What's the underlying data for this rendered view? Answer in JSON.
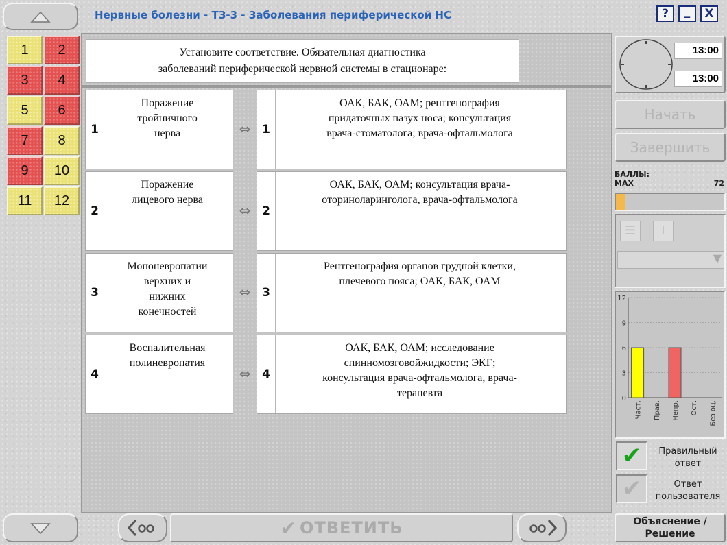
{
  "window": {
    "title": "Нервные болезни - ТЗ-3 - Заболевания периферической НС",
    "help_label": "?",
    "minimize_label": "_",
    "close_label": "X"
  },
  "questions": [
    {
      "label": "1",
      "status": "yellow"
    },
    {
      "label": "2",
      "status": "red"
    },
    {
      "label": "3",
      "status": "red"
    },
    {
      "label": "4",
      "status": "red"
    },
    {
      "label": "5",
      "status": "yellow"
    },
    {
      "label": "6",
      "status": "red"
    },
    {
      "label": "7",
      "status": "red"
    },
    {
      "label": "8",
      "status": "yellow"
    },
    {
      "label": "9",
      "status": "red"
    },
    {
      "label": "10",
      "status": "yellow"
    },
    {
      "label": "11",
      "status": "yellow"
    },
    {
      "label": "12",
      "status": "yellow"
    }
  ],
  "question": {
    "line1": "Установите соответствие. Обязательная диагностика",
    "line2": "заболеваний периферической нервной системы в стационаре:"
  },
  "left_items": [
    {
      "num": "1",
      "lines": [
        "Поражение",
        "тройничного",
        "нерва"
      ]
    },
    {
      "num": "2",
      "lines": [
        "Поражение",
        "лицевого нерва"
      ]
    },
    {
      "num": "3",
      "lines": [
        "Мононевропатии",
        "верхних и",
        "нижних",
        "конечностей"
      ]
    },
    {
      "num": "4",
      "lines": [
        "Воспалительная",
        "полиневропатия"
      ]
    }
  ],
  "right_items": [
    {
      "num": "1",
      "lines": [
        "ОАК, БАК, ОАМ; рентгенография",
        "придаточных пазух носа; консультация",
        "врача-стоматолога; врача-офтальмолога"
      ]
    },
    {
      "num": "2",
      "lines": [
        "ОАК, БАК, ОАМ; консультация врача-",
        "оториноларинголога, врача-офтальмолога"
      ]
    },
    {
      "num": "3",
      "lines": [
        "Рентгенография органов грудной клетки,",
        "плечевого пояса; ОАК, БАК, ОАМ"
      ]
    },
    {
      "num": "4",
      "lines": [
        "ОАК, БАК, ОАМ; исследование",
        "спинномозговойжидкости; ЭКГ;",
        "консультация врача-офтальмолога, врача-",
        "терапевта"
      ]
    }
  ],
  "match_arrow": "⇔",
  "bottom": {
    "answer_label": "ОТВЕТИТЬ",
    "explain_line1": "Объяснение /",
    "explain_line2": "Решение"
  },
  "timer": {
    "time_top": "13:00",
    "time_bottom": "13:00"
  },
  "controls": {
    "start_label": "Начать",
    "finish_label": "Завершить"
  },
  "score": {
    "label": "БАЛЛЫ:",
    "max_label": "MAX",
    "max_value": "72",
    "progress_fraction": 0.08
  },
  "chart_data": {
    "type": "bar",
    "categories": [
      "Част.",
      "Прав.",
      "Непр.",
      "Ост.",
      "Без оц."
    ],
    "values": [
      6,
      0,
      6,
      0,
      0
    ],
    "colors": [
      "#ffff00",
      "#ffff00",
      "#f06464",
      "#cccccc",
      "#cccccc"
    ],
    "yticks": [
      "0",
      "3",
      "6",
      "9",
      "12"
    ],
    "ylim": [
      0,
      12
    ]
  },
  "legend": {
    "correct_line1": "Правильный",
    "correct_line2": "ответ",
    "user_line1": "Ответ",
    "user_line2": "пользователя"
  },
  "icons": {
    "up": "triangle-up-icon",
    "down": "triangle-down-icon",
    "prev": "prev-arrow-icon",
    "next": "next-arrow-icon",
    "check": "checkmark-icon",
    "clock": "clock-icon"
  },
  "colors": {
    "title": "#2b63b6",
    "question_yellow": "#ebe277",
    "question_red": "#e35151",
    "progress": "#f5b94a",
    "check_green": "#17a317"
  }
}
